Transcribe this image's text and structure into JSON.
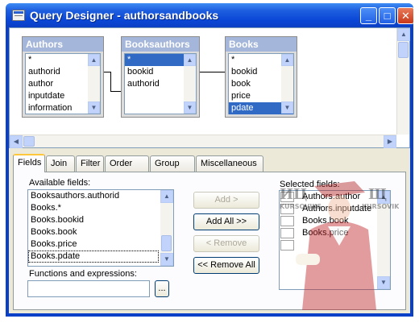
{
  "window": {
    "title": "Query Designer - authorsandbooks",
    "minimize_label": "_",
    "maximize_label": "□",
    "close_label": "✕"
  },
  "diagram": {
    "tables": [
      {
        "name": "Authors",
        "fields": [
          "*",
          "authorid",
          "author",
          "inputdate",
          "information"
        ],
        "selected_index": -1
      },
      {
        "name": "Booksauthors",
        "fields": [
          "*",
          "bookid",
          "authorid"
        ],
        "selected_index": 0
      },
      {
        "name": "Books",
        "fields": [
          "*",
          "bookid",
          "book",
          "price",
          "pdate"
        ],
        "selected_index": 4
      }
    ]
  },
  "tabs": [
    {
      "label": "Fields",
      "active": true
    },
    {
      "label": "Join",
      "active": false
    },
    {
      "label": "Filter",
      "active": false
    },
    {
      "label": "Order By",
      "active": false
    },
    {
      "label": "Group By",
      "active": false
    },
    {
      "label": "Miscellaneous",
      "active": false
    }
  ],
  "fields_tab": {
    "available_label": "Available fields:",
    "available_fields": [
      "Booksauthors.authorid",
      "Books.*",
      "Books.bookid",
      "Books.book",
      "Books.price",
      "Books.pdate"
    ],
    "focused_index": 5,
    "functions_label": "Functions and expressions:",
    "functions_value": "",
    "browse_label": "...",
    "add_label": "Add >",
    "add_all_label": "Add All >>",
    "remove_label": "< Remove",
    "remove_all_label": "<< Remove All",
    "selected_label": "Selected fields:",
    "selected_fields": [
      "Authors.author",
      "Authors.inputdate",
      "Books.book",
      "Books.price"
    ]
  },
  "watermark": {
    "left_text": "ИЦ",
    "left_brand": "KURSOVIKS",
    "right_text": "Щ",
    "right_brand": "KURSOVIKS"
  }
}
